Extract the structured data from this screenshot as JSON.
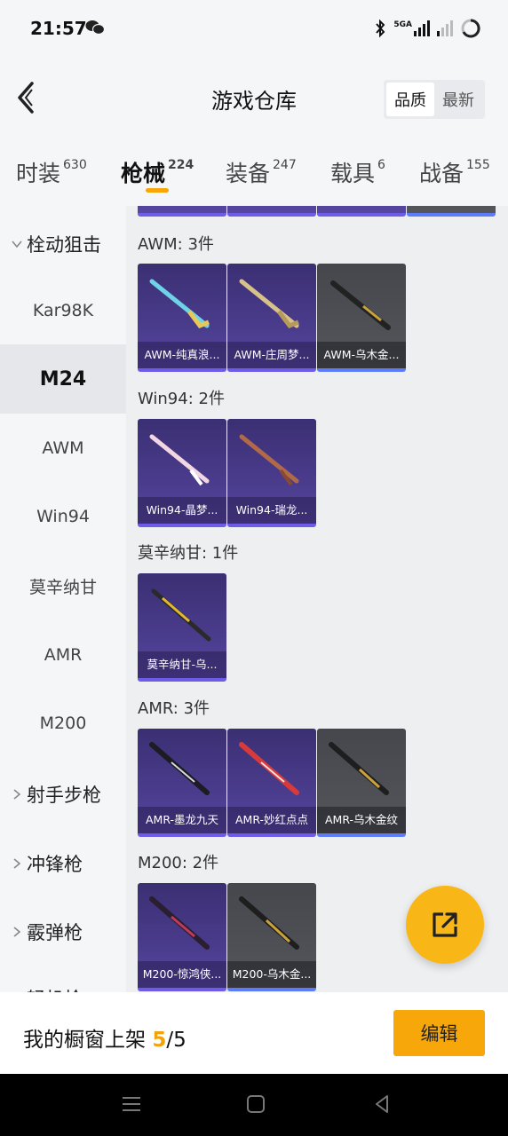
{
  "status_bar": {
    "time": "21:57",
    "icons": [
      "wechat-icon",
      "bluetooth-icon",
      "signal-5g-icon",
      "signal-icon",
      "battery-icon"
    ],
    "network": "5GA"
  },
  "header": {
    "title": "游戏仓库",
    "sort_options": [
      "品质",
      "最新"
    ],
    "active_sort": "品质"
  },
  "tabs": [
    {
      "label": "时装",
      "count": "630"
    },
    {
      "label": "枪械",
      "count": "224",
      "active": true
    },
    {
      "label": "装备",
      "count": "247"
    },
    {
      "label": "载具",
      "count": "6"
    },
    {
      "label": "战备",
      "count": "155"
    }
  ],
  "sidebar": {
    "groups": [
      {
        "label": "栓动狙击",
        "expanded": true
      },
      {
        "label": "射手步枪"
      },
      {
        "label": "冲锋枪"
      },
      {
        "label": "霰弹枪"
      },
      {
        "label": "轻机枪"
      }
    ],
    "items": [
      "Kar98K",
      "M24",
      "AWM",
      "Win94",
      "莫辛纳甘",
      "AMR",
      "M200"
    ],
    "active_item": "M24"
  },
  "sections": [
    {
      "title": "AWM: 3件",
      "items": [
        {
          "label": "AWM-纯真浪...",
          "style": "purple"
        },
        {
          "label": "AWM-庄周梦...",
          "style": "purple"
        },
        {
          "label": "AWM-乌木金...",
          "style": "gray"
        }
      ]
    },
    {
      "title": "Win94: 2件",
      "items": [
        {
          "label": "Win94-晶梦...",
          "style": "purple"
        },
        {
          "label": "Win94-瑞龙...",
          "style": "purple"
        }
      ]
    },
    {
      "title": "莫辛纳甘: 1件",
      "items": [
        {
          "label": "莫辛纳甘-乌...",
          "style": "purple"
        }
      ]
    },
    {
      "title": "AMR: 3件",
      "items": [
        {
          "label": "AMR-墨龙九天",
          "style": "purple"
        },
        {
          "label": "AMR-妙红点点",
          "style": "purple"
        },
        {
          "label": "AMR-乌木金纹",
          "style": "gray"
        }
      ]
    },
    {
      "title": "M200: 2件",
      "items": [
        {
          "label": "M200-惊鸿侠...",
          "style": "purple"
        },
        {
          "label": "M200-乌木金...",
          "style": "gray"
        }
      ]
    }
  ],
  "bottom": {
    "showcase_label": "我的橱窗上架",
    "count_current": "5",
    "count_total": "/5",
    "edit_label": "编辑"
  },
  "colors": {
    "accent": "#f7a70a",
    "card_purple": "#4a3c8c",
    "card_gray": "#54565c"
  }
}
